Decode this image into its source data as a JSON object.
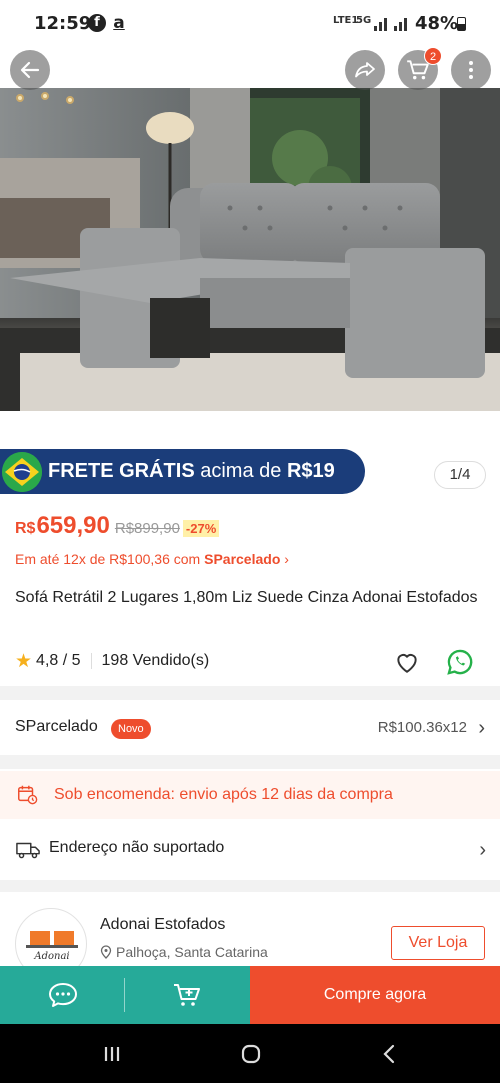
{
  "status_bar": {
    "time": "12:59",
    "network": "5G",
    "volte": "LTE1",
    "battery": "48%"
  },
  "header": {
    "back_icon": "arrow-left-icon",
    "share_icon": "share-icon",
    "cart_icon": "cart-icon",
    "cart_badge": "2",
    "more_icon": "more-vertical-icon"
  },
  "gallery": {
    "counter": "1/4"
  },
  "banner": {
    "bold": "FRETE GRÁTIS",
    "normal": " acima de ",
    "amount": "R$19"
  },
  "product": {
    "currency": "R$",
    "price": "659,90",
    "old_price": "R$899,90",
    "discount": "-27%",
    "installments": "Em até 12x de R$100,36 com ",
    "installments_brand": "SParcelado",
    "title": "Sofá Retrátil 2 Lugares 1,80m Liz Suede Cinza Adonai Estofados",
    "rating": "4,8 / 5",
    "sold": "198 Vendido(s)"
  },
  "sparcelado": {
    "label": "SParcelado",
    "badge": "Novo",
    "value": "R$100.36x12"
  },
  "notice": {
    "text": "Sob encomenda: envio após 12 dias da compra"
  },
  "address": {
    "text": "Endereço não suportado"
  },
  "shop": {
    "name": "Adonai Estofados",
    "location": "Palhoça, Santa Catarina",
    "logo_text": "Adonai",
    "button": "Ver Loja"
  },
  "bottom_bar": {
    "buy_label": "Compre agora"
  },
  "colors": {
    "accent": "#ee4d2d",
    "teal": "#26aa99",
    "banner_blue": "#1b3d7a"
  }
}
